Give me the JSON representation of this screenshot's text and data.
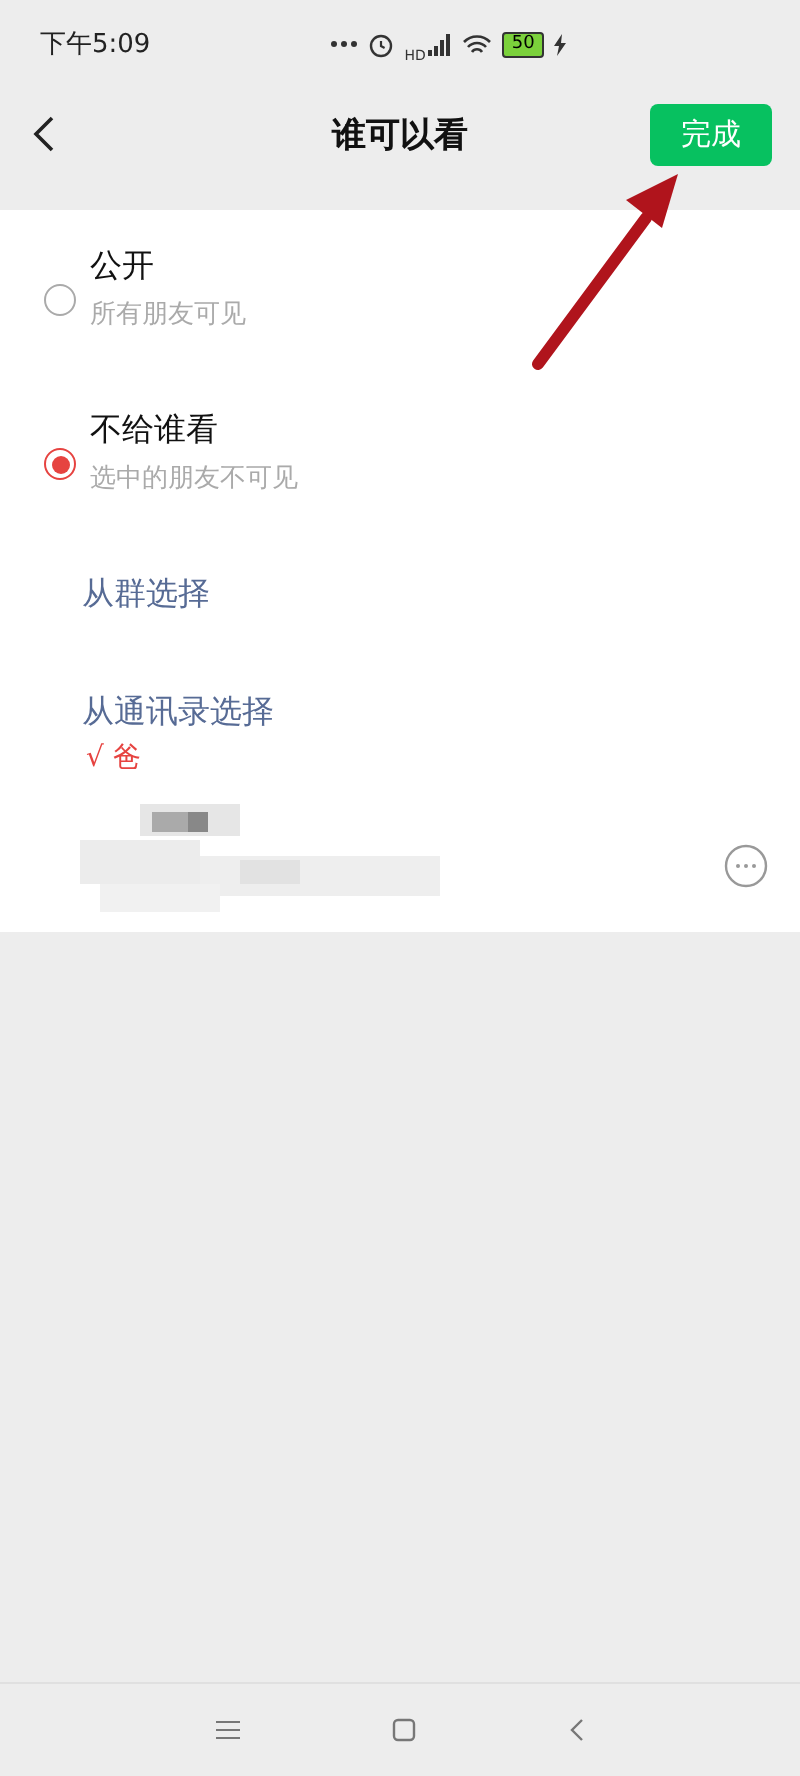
{
  "status_bar": {
    "time": "下午5:09",
    "network_label": "HD",
    "battery": "50"
  },
  "header": {
    "title": "谁可以看",
    "done_button": "完成"
  },
  "options": [
    {
      "label": "公开",
      "description": "所有朋友可见",
      "selected": false
    },
    {
      "label": "不给谁看",
      "description": "选中的朋友不可见",
      "selected": true
    }
  ],
  "choose_from_group": "从群选择",
  "choose_from_contacts": {
    "label": "从通讯录选择",
    "picked": "√ 爸"
  }
}
